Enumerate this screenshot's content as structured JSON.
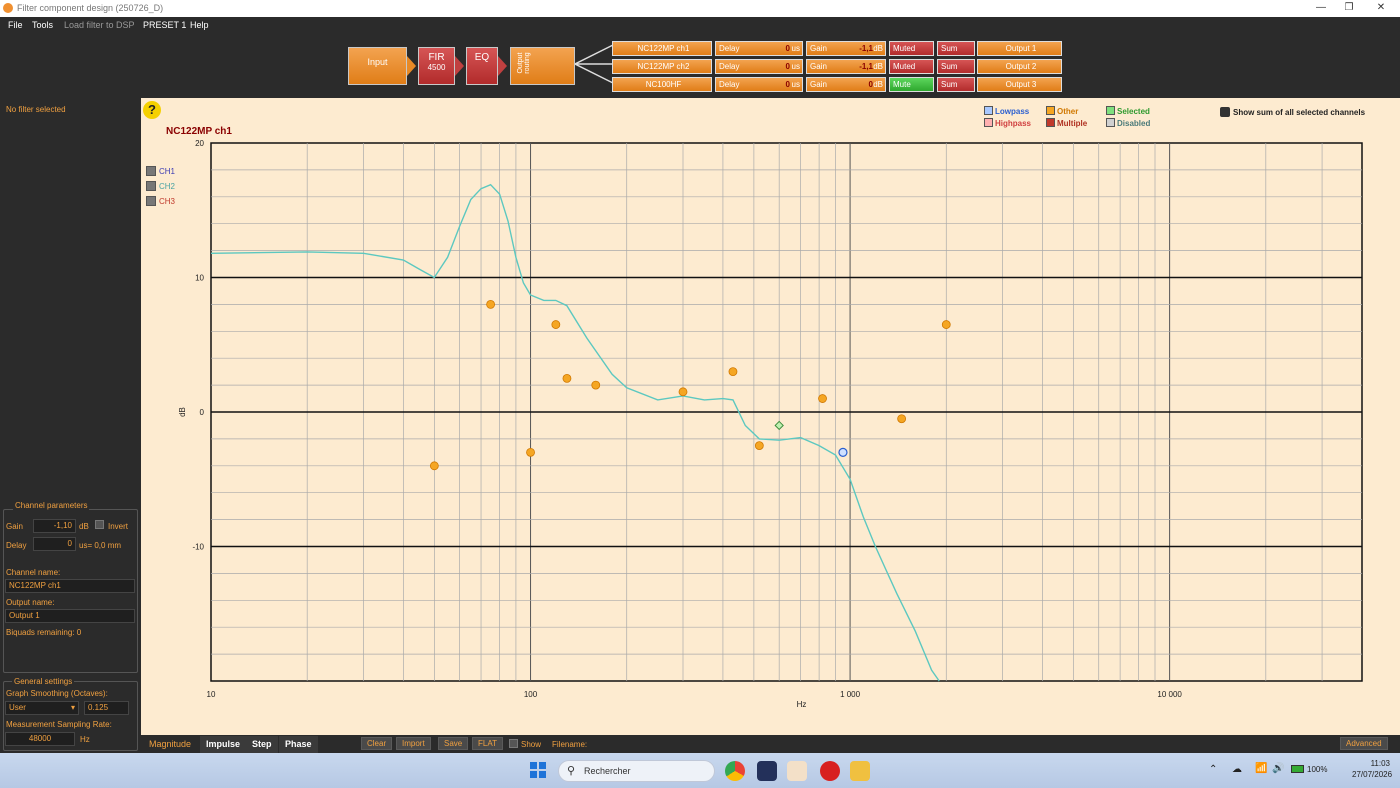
{
  "window": {
    "title": "Filter component design (250726_D)",
    "minimize": "—",
    "maximize": "❐",
    "close": "✕"
  },
  "menu": [
    "File",
    "Tools",
    "Load filter to DSP",
    "PRESET 1",
    "Help"
  ],
  "pipeline": {
    "input": "Input",
    "fir": "FIR",
    "fir_taps": "4500",
    "eq": "EQ",
    "routing": "Output routing",
    "rows": [
      {
        "name": "NC122MP ch1",
        "delay_label": "Delay",
        "delay_val": "0",
        "delay_unit": "us",
        "gain_label": "Gain",
        "gain_val": "-1,1",
        "gain_unit": "dB",
        "mute": "Muted",
        "sum": "Sum",
        "output": "Output 1"
      },
      {
        "name": "NC122MP ch2",
        "delay_label": "Delay",
        "delay_val": "0",
        "delay_unit": "us",
        "gain_label": "Gain",
        "gain_val": "-1,1",
        "gain_unit": "dB",
        "mute": "Muted",
        "sum": "Sum",
        "output": "Output 2"
      },
      {
        "name": "NC100HF",
        "delay_label": "Delay",
        "delay_val": "0",
        "delay_unit": "us",
        "gain_label": "Gain",
        "gain_val": "0",
        "gain_unit": "dB",
        "mute": "Mute",
        "sum": "Sum",
        "output": "Output 3"
      }
    ]
  },
  "left": {
    "no_filter": "No filter selected",
    "channel_params": "Channel parameters",
    "gain_label": "Gain",
    "gain_val": "-1,10",
    "gain_unit": "dB",
    "invert": "Invert",
    "delay_label": "Delay",
    "delay_val": "0",
    "delay_unit": "us= 0,0 mm",
    "channel_name_label": "Channel name:",
    "channel_name": "NC122MP ch1",
    "output_name_label": "Output name:",
    "output_name": "Output 1",
    "biquads": "Biquads remaining: 0",
    "general": "General settings",
    "smoothing_label": "Graph Smoothing (Octaves):",
    "smoothing_mode": "User",
    "smoothing_val": "0.125",
    "sampling_label": "Measurement Sampling Rate:",
    "sampling_val": "48000",
    "sampling_unit": "Hz"
  },
  "graph": {
    "help": "?",
    "channel_title": "NC122MP ch1",
    "channels": [
      {
        "name": "CH1",
        "color": "#3b3bb3"
      },
      {
        "name": "CH2",
        "color": "#4aa3a3"
      },
      {
        "name": "CH3",
        "color": "#c0392b"
      }
    ],
    "legend": [
      {
        "label": "Lowpass",
        "color": "#a8c8ff",
        "text": "#2a5fd0"
      },
      {
        "label": "Highpass",
        "color": "#ffb0b0",
        "text": "#d04040"
      },
      {
        "label": "Other",
        "color": "#f5a623",
        "text": "#d07800"
      },
      {
        "label": "Multiple",
        "color": "#c0392b",
        "text": "#b03020"
      },
      {
        "label": "Selected",
        "color": "#7ee07e",
        "text": "#2e9a2e"
      },
      {
        "label": "Disabled",
        "color": "#d0d0d0",
        "text": "#4a7a7a"
      }
    ],
    "show_sum": "Show sum of all selected channels",
    "ylabel": "dB",
    "xlabel": "Hz",
    "curve_color": "#5cc8c0",
    "point_color": "#f5a623"
  },
  "chart_data": {
    "type": "line",
    "title": "NC122MP ch1",
    "xlabel": "Hz",
    "ylabel": "dB",
    "xscale": "log",
    "xlim": [
      10,
      40000
    ],
    "ylim": [
      -20,
      20
    ],
    "xticks": [
      "10",
      "100",
      "1000",
      "10000"
    ],
    "yticks": [
      "20",
      "10",
      "0",
      "-10"
    ],
    "grid": true,
    "series": [
      {
        "name": "CH2",
        "x": [
          10,
          20,
          30,
          40,
          45,
          50,
          55,
          60,
          65,
          70,
          75,
          80,
          85,
          90,
          95,
          100,
          110,
          120,
          130,
          150,
          180,
          200,
          250,
          300,
          350,
          400,
          430,
          470,
          520,
          600,
          700,
          800,
          900,
          1000,
          1100,
          1200,
          1400,
          1600,
          1800,
          1900
        ],
        "y": [
          11.8,
          11.9,
          11.8,
          11.3,
          10.6,
          10,
          11.5,
          13.8,
          15.8,
          16.6,
          16.9,
          16.2,
          14.2,
          11.5,
          9.6,
          8.7,
          8.3,
          8.3,
          7.9,
          5.5,
          2.8,
          1.8,
          0.9,
          1.2,
          0.9,
          1,
          0.9,
          -1,
          -2,
          -2.1,
          -1.9,
          -2.5,
          -3.2,
          -5,
          -7.8,
          -10,
          -13.5,
          -16.3,
          -19.2,
          -20
        ]
      }
    ],
    "filter_points": [
      {
        "x": 50,
        "y": -4,
        "type": "Other"
      },
      {
        "x": 75,
        "y": 8,
        "type": "Other"
      },
      {
        "x": 100,
        "y": -3,
        "type": "Other"
      },
      {
        "x": 120,
        "y": 6.5,
        "type": "Other"
      },
      {
        "x": 130,
        "y": 2.5,
        "type": "Other"
      },
      {
        "x": 160,
        "y": 2,
        "type": "Other"
      },
      {
        "x": 300,
        "y": 1.5,
        "type": "Other"
      },
      {
        "x": 430,
        "y": 3,
        "type": "Other"
      },
      {
        "x": 520,
        "y": -2.5,
        "type": "Other"
      },
      {
        "x": 600,
        "y": -1,
        "type": "Selected"
      },
      {
        "x": 820,
        "y": 1,
        "type": "Other"
      },
      {
        "x": 950,
        "y": -3,
        "type": "Lowpass"
      },
      {
        "x": 1450,
        "y": -0.5,
        "type": "Other"
      },
      {
        "x": 2000,
        "y": 6.5,
        "type": "Other"
      }
    ]
  },
  "bottom": {
    "tabs": [
      "Magnitude",
      "Impulse",
      "Step",
      "Phase"
    ],
    "buttons": [
      "Clear",
      "Import",
      "Save",
      "FLAT"
    ],
    "show": "Show",
    "filename": "Filename:",
    "advanced": "Advanced"
  },
  "taskbar": {
    "search": "Rechercher",
    "time": "11:03",
    "date": "27/07/2026",
    "battery": "100%"
  }
}
